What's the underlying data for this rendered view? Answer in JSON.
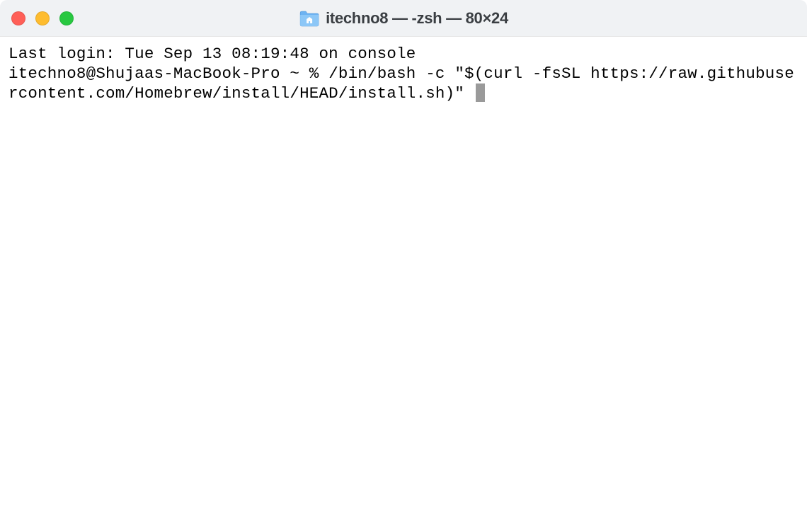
{
  "window": {
    "title": "itechno8 — -zsh — 80×24"
  },
  "terminal": {
    "last_login": "Last login: Tue Sep 13 08:19:48 on console",
    "prompt": "itechno8@Shujaas-MacBook-Pro ~ % ",
    "command": "/bin/bash -c \"$(curl -fsSL https://raw.githubusercontent.com/Homebrew/install/HEAD/install.sh)\" "
  }
}
